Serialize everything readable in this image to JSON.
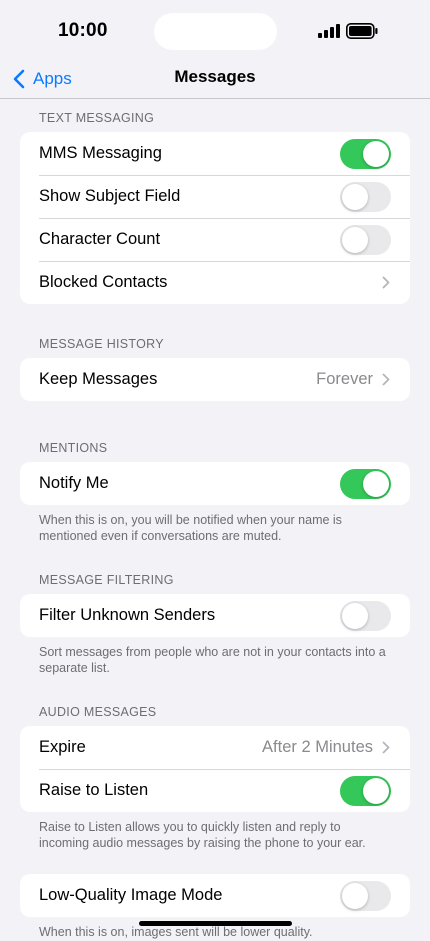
{
  "status_bar": {
    "time": "10:00"
  },
  "nav": {
    "back_label": "Apps",
    "title": "Messages"
  },
  "sections": {
    "text_messaging": {
      "header": "TEXT MESSAGING",
      "rows": [
        {
          "label": "MMS Messaging",
          "toggle": "on"
        },
        {
          "label": "Show Subject Field",
          "toggle": "off"
        },
        {
          "label": "Character Count",
          "toggle": "off"
        },
        {
          "label": "Blocked Contacts"
        }
      ]
    },
    "message_history": {
      "header": "MESSAGE HISTORY",
      "rows": [
        {
          "label": "Keep Messages",
          "value": "Forever"
        }
      ]
    },
    "mentions": {
      "header": "MENTIONS",
      "rows": [
        {
          "label": "Notify Me",
          "toggle": "on"
        }
      ],
      "footer": "When this is on, you will be notified when your name is mentioned even if conversations are muted."
    },
    "message_filtering": {
      "header": "MESSAGE FILTERING",
      "rows": [
        {
          "label": "Filter Unknown Senders",
          "toggle": "off"
        }
      ],
      "footer": "Sort messages from people who are not in your contacts into a separate list."
    },
    "audio_messages": {
      "header": "AUDIO MESSAGES",
      "rows": [
        {
          "label": "Expire",
          "value": "After 2 Minutes"
        },
        {
          "label": "Raise to Listen",
          "toggle": "on"
        }
      ],
      "footer": "Raise to Listen allows you to quickly listen and reply to incoming audio messages by raising the phone to your ear."
    },
    "image_mode": {
      "rows": [
        {
          "label": "Low-Quality Image Mode",
          "toggle": "off"
        }
      ],
      "footer": "When this is on, images sent will be lower quality."
    }
  },
  "colors": {
    "accent": "#0a7aff",
    "toggle_on": "#34c759",
    "toggle_off": "#e9e9eb",
    "background": "#f2f2f7"
  },
  "icons": {
    "back": "chevron-left-icon",
    "disclosure": "chevron-right-icon",
    "signal": "cellular-signal-icon",
    "battery": "battery-icon"
  }
}
